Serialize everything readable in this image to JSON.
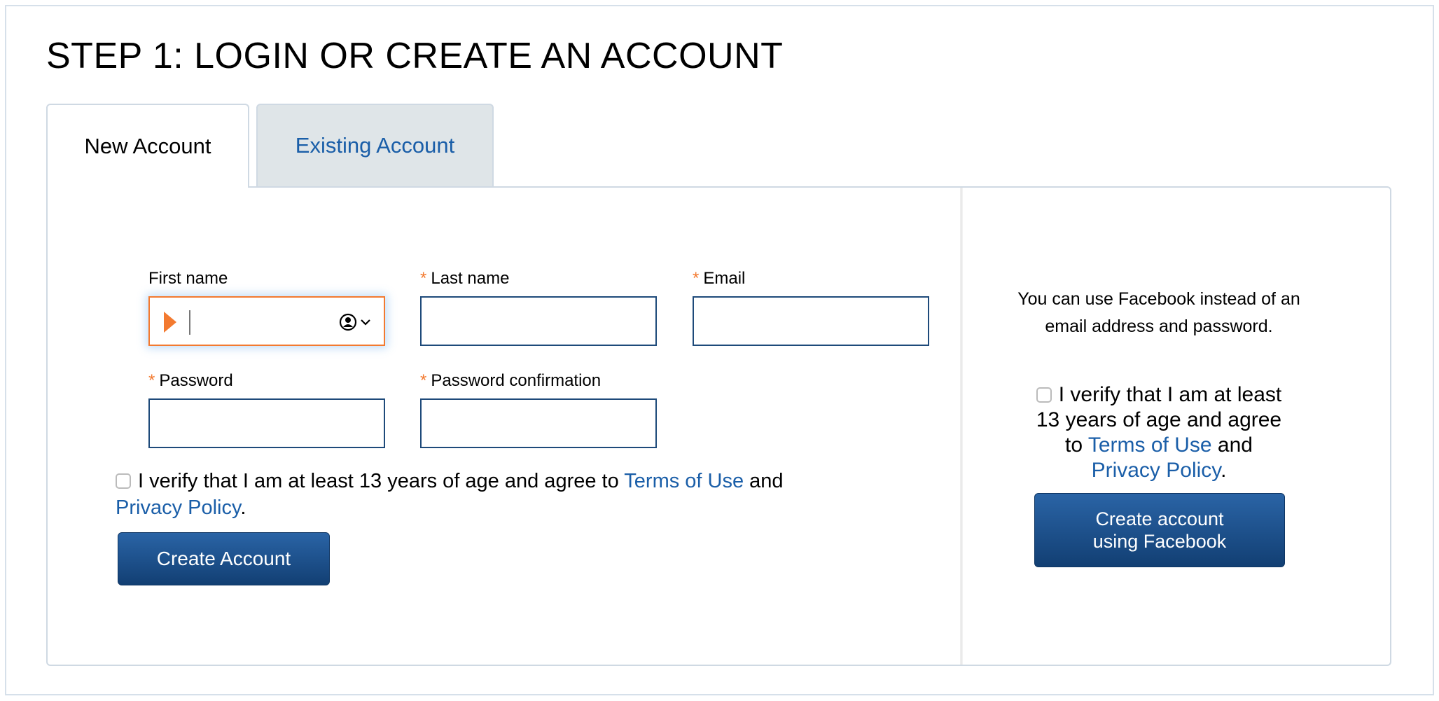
{
  "page_title": "STEP 1: LOGIN OR CREATE AN ACCOUNT",
  "tabs": [
    {
      "label": "New Account",
      "active": true
    },
    {
      "label": "Existing Account",
      "active": false
    }
  ],
  "form": {
    "first_name": {
      "label": "First name",
      "value": "",
      "required": false
    },
    "last_name": {
      "label": "Last name",
      "value": "",
      "required": true
    },
    "email": {
      "label": "Email",
      "value": "",
      "required": true
    },
    "password": {
      "label": "Password",
      "value": "",
      "required": true
    },
    "password_confirmation": {
      "label": "Password confirmation",
      "value": "",
      "required": true
    },
    "required_marker": "*",
    "agree": {
      "text_before": "I verify that I am at least 13 years of age and agree to",
      "terms": "Terms of Use",
      "and": "and",
      "privacy": "Privacy Policy",
      "period": ".",
      "checked": false
    },
    "submit_label": "Create Account"
  },
  "facebook": {
    "intro": "You can use Facebook instead of an email address and password.",
    "agree": {
      "text_before": "I verify that I am at least 13 years of age and agree to",
      "terms": "Terms of Use",
      "and": "and",
      "privacy": "Privacy Policy",
      "period": ".",
      "checked": false
    },
    "button_label": "Create account using Facebook"
  },
  "colors": {
    "accent": "#1a5ea8",
    "required": "#f37a30",
    "button": "#1d528f",
    "focus_border": "#f37a30"
  },
  "icons": {
    "autofill": "contact-card-icon",
    "password_manager": "play-arrow-icon"
  }
}
